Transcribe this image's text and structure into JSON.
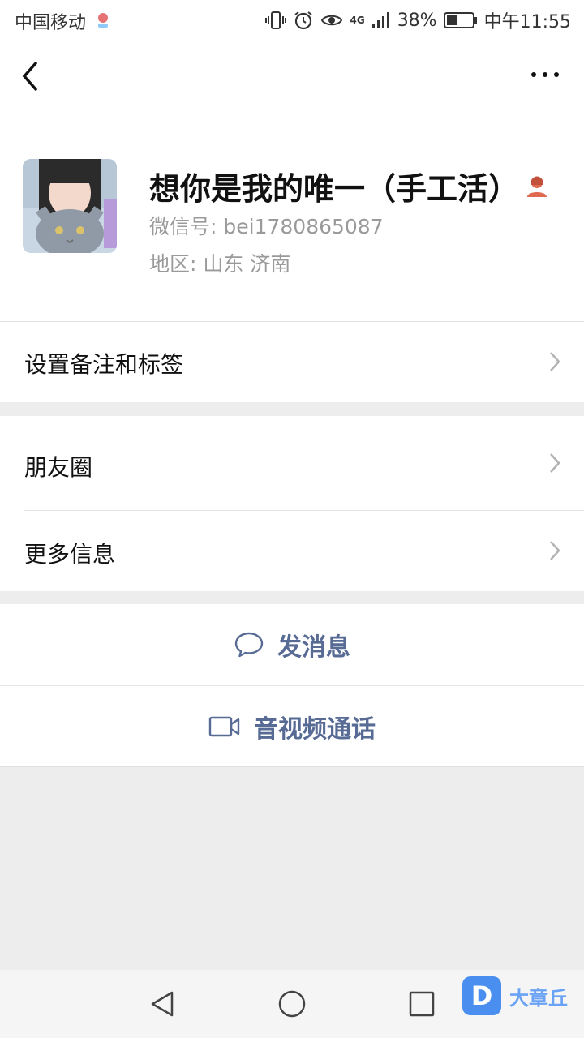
{
  "status_bar": {
    "carrier": "中国移动",
    "network": "4G",
    "battery": "38%",
    "time": "中午11:55"
  },
  "nav": {
    "back_icon": "chevron-left-icon",
    "more_icon": "ellipsis-icon"
  },
  "profile": {
    "name": "想你是我的唯一（手工活）",
    "wechat_id": "微信号: bei1780865087",
    "region": "地区: 山东  济南",
    "gender_icon": "female-user-icon",
    "gender_color": "#e06a4f"
  },
  "rows": {
    "remark": "设置备注和标签",
    "moments": "朋友圈",
    "more_info": "更多信息"
  },
  "actions": {
    "message": "发消息",
    "call": "音视频通话",
    "accent_color": "#576b95"
  },
  "watermark": {
    "badge": "D",
    "text": "大章丘"
  }
}
